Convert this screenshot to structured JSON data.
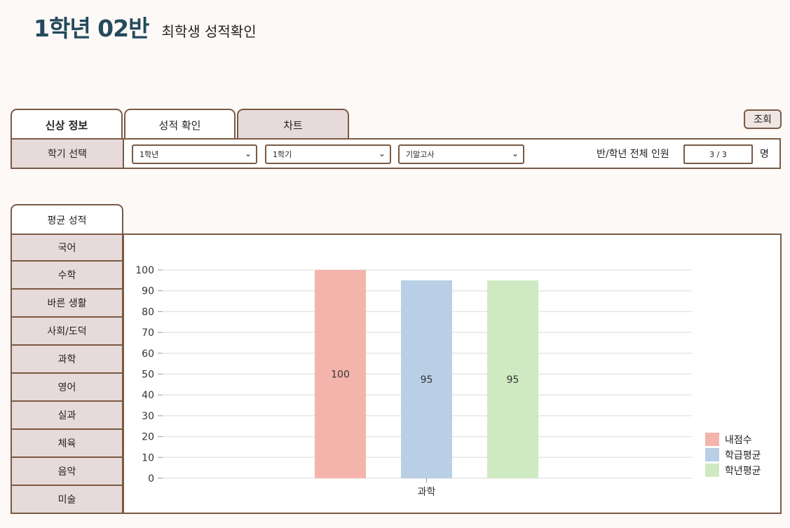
{
  "header": {
    "class_title": "1학년 02반",
    "subtitle": "최학생 성적확인"
  },
  "tabs": [
    {
      "label": "신상 정보"
    },
    {
      "label": "성적 확인"
    },
    {
      "label": "차트"
    }
  ],
  "search_button": "조회",
  "filter": {
    "label": "학기 선택",
    "grade_select": "1학년",
    "term_select": "1학기",
    "exam_select": "기말고사",
    "count_label": "반/학년 전체 인원",
    "count_value": "3 / 3",
    "count_unit": "명"
  },
  "side_panel": {
    "header": "평균 성적",
    "subjects": [
      "국어",
      "수학",
      "바른 생활",
      "사회/도덕",
      "과학",
      "영어",
      "실과",
      "체육",
      "음악",
      "미술"
    ]
  },
  "chart_data": {
    "type": "bar",
    "categories": [
      "과학"
    ],
    "series": [
      {
        "name": "내점수",
        "values": [
          100
        ],
        "color": "#f4b4ab"
      },
      {
        "name": "학급평균",
        "values": [
          95
        ],
        "color": "#b9cfe5"
      },
      {
        "name": "학년평균",
        "values": [
          95
        ],
        "color": "#cfeac3"
      }
    ],
    "ylim": [
      0,
      100
    ],
    "yticks": [
      0,
      10,
      20,
      30,
      40,
      50,
      60,
      70,
      80,
      90,
      100
    ],
    "grid": true,
    "legend": "bottom-right"
  }
}
